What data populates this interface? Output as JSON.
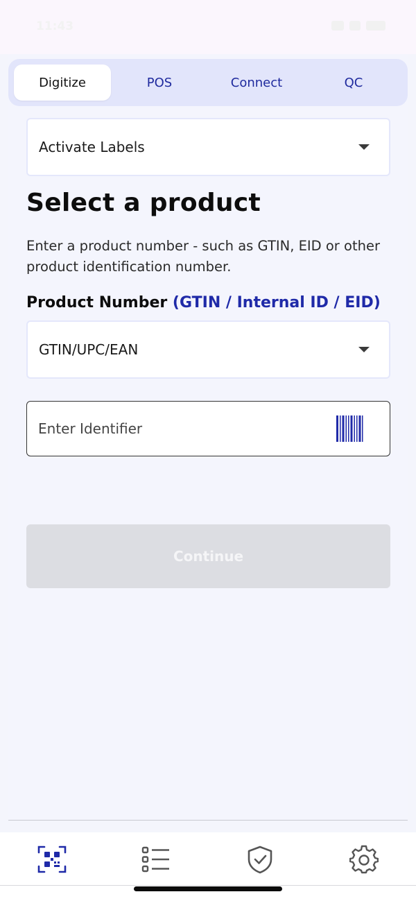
{
  "status_bar": {
    "time": "11:43"
  },
  "tabs": [
    {
      "label": "Digitize",
      "active": true
    },
    {
      "label": "POS",
      "active": false
    },
    {
      "label": "Connect",
      "active": false
    },
    {
      "label": "QC",
      "active": false
    }
  ],
  "mode_select": {
    "value": "Activate Labels"
  },
  "main": {
    "title": "Select a product",
    "description": "Enter a product number - such as GTIN, EID or other product identification number.",
    "field_label": "Product Number",
    "field_hint": "(GTIN / Internal ID / EID)"
  },
  "type_select": {
    "value": "GTIN/UPC/EAN"
  },
  "identifier_input": {
    "value": "",
    "placeholder": "Enter Identifier"
  },
  "continue_button": {
    "label": "Continue",
    "enabled": false
  },
  "bottom_nav": [
    {
      "icon": "qr-scan-icon",
      "active": true
    },
    {
      "icon": "list-icon",
      "active": false
    },
    {
      "icon": "shield-check-icon",
      "active": false
    },
    {
      "icon": "gear-icon",
      "active": false
    }
  ],
  "colors": {
    "accent": "#1f2aa8",
    "tab_bar_bg": "#e2e5fb",
    "page_bg": "#f4f5fc",
    "disabled_button": "#dcdde2"
  }
}
